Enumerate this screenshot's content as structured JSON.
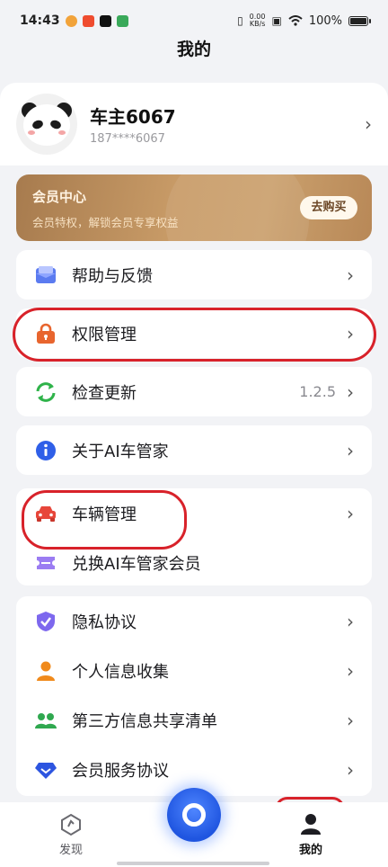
{
  "status_bar": {
    "time": "14:43",
    "net_speed": "0.00",
    "net_unit": "KB/s",
    "battery": "100%"
  },
  "page_title": "我的",
  "profile": {
    "name": "车主6067",
    "phone": "187****6067"
  },
  "member": {
    "title": "会员中心",
    "subtitle": "会员特权，解锁会员专享权益",
    "button": "去购买"
  },
  "menu": {
    "help": "帮助与反馈",
    "permission": "权限管理",
    "update": "检查更新",
    "update_version": "1.2.5",
    "about": "关于AI车管家",
    "vehicle": "车辆管理",
    "redeem": "兑换AI车管家会员",
    "privacy": "隐私协议",
    "personal_info": "个人信息收集",
    "third_party": "第三方信息共享清单",
    "member_agreement": "会员服务协议"
  },
  "tabs": {
    "discover": "发现",
    "mine": "我的"
  },
  "colors": {
    "accent_blue": "#2f64ec",
    "annotation_red": "#d8222a",
    "gold": "#c89b67"
  }
}
